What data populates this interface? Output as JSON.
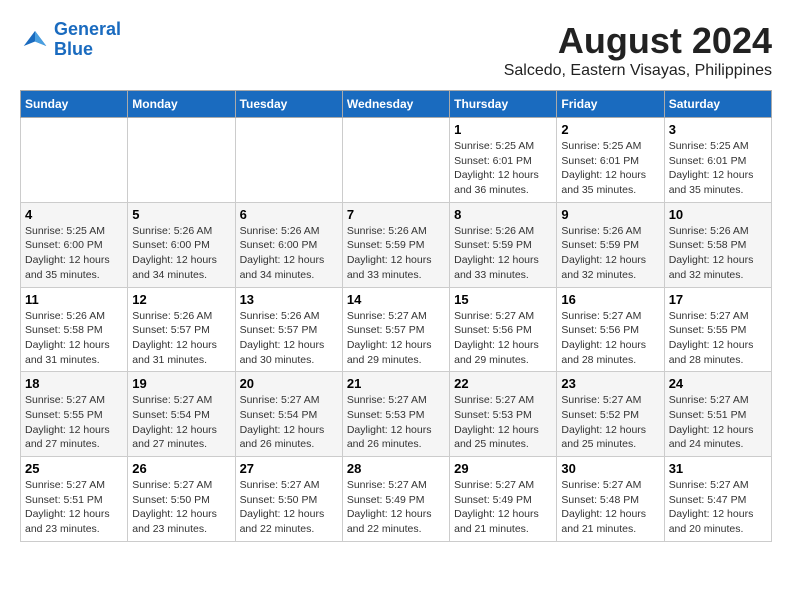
{
  "logo": {
    "line1": "General",
    "line2": "Blue"
  },
  "title": "August 2024",
  "subtitle": "Salcedo, Eastern Visayas, Philippines",
  "days_of_week": [
    "Sunday",
    "Monday",
    "Tuesday",
    "Wednesday",
    "Thursday",
    "Friday",
    "Saturday"
  ],
  "weeks": [
    [
      {
        "day": "",
        "info": ""
      },
      {
        "day": "",
        "info": ""
      },
      {
        "day": "",
        "info": ""
      },
      {
        "day": "",
        "info": ""
      },
      {
        "day": "1",
        "info": "Sunrise: 5:25 AM\nSunset: 6:01 PM\nDaylight: 12 hours\nand 36 minutes."
      },
      {
        "day": "2",
        "info": "Sunrise: 5:25 AM\nSunset: 6:01 PM\nDaylight: 12 hours\nand 35 minutes."
      },
      {
        "day": "3",
        "info": "Sunrise: 5:25 AM\nSunset: 6:01 PM\nDaylight: 12 hours\nand 35 minutes."
      }
    ],
    [
      {
        "day": "4",
        "info": "Sunrise: 5:25 AM\nSunset: 6:00 PM\nDaylight: 12 hours\nand 35 minutes."
      },
      {
        "day": "5",
        "info": "Sunrise: 5:26 AM\nSunset: 6:00 PM\nDaylight: 12 hours\nand 34 minutes."
      },
      {
        "day": "6",
        "info": "Sunrise: 5:26 AM\nSunset: 6:00 PM\nDaylight: 12 hours\nand 34 minutes."
      },
      {
        "day": "7",
        "info": "Sunrise: 5:26 AM\nSunset: 5:59 PM\nDaylight: 12 hours\nand 33 minutes."
      },
      {
        "day": "8",
        "info": "Sunrise: 5:26 AM\nSunset: 5:59 PM\nDaylight: 12 hours\nand 33 minutes."
      },
      {
        "day": "9",
        "info": "Sunrise: 5:26 AM\nSunset: 5:59 PM\nDaylight: 12 hours\nand 32 minutes."
      },
      {
        "day": "10",
        "info": "Sunrise: 5:26 AM\nSunset: 5:58 PM\nDaylight: 12 hours\nand 32 minutes."
      }
    ],
    [
      {
        "day": "11",
        "info": "Sunrise: 5:26 AM\nSunset: 5:58 PM\nDaylight: 12 hours\nand 31 minutes."
      },
      {
        "day": "12",
        "info": "Sunrise: 5:26 AM\nSunset: 5:57 PM\nDaylight: 12 hours\nand 31 minutes."
      },
      {
        "day": "13",
        "info": "Sunrise: 5:26 AM\nSunset: 5:57 PM\nDaylight: 12 hours\nand 30 minutes."
      },
      {
        "day": "14",
        "info": "Sunrise: 5:27 AM\nSunset: 5:57 PM\nDaylight: 12 hours\nand 29 minutes."
      },
      {
        "day": "15",
        "info": "Sunrise: 5:27 AM\nSunset: 5:56 PM\nDaylight: 12 hours\nand 29 minutes."
      },
      {
        "day": "16",
        "info": "Sunrise: 5:27 AM\nSunset: 5:56 PM\nDaylight: 12 hours\nand 28 minutes."
      },
      {
        "day": "17",
        "info": "Sunrise: 5:27 AM\nSunset: 5:55 PM\nDaylight: 12 hours\nand 28 minutes."
      }
    ],
    [
      {
        "day": "18",
        "info": "Sunrise: 5:27 AM\nSunset: 5:55 PM\nDaylight: 12 hours\nand 27 minutes."
      },
      {
        "day": "19",
        "info": "Sunrise: 5:27 AM\nSunset: 5:54 PM\nDaylight: 12 hours\nand 27 minutes."
      },
      {
        "day": "20",
        "info": "Sunrise: 5:27 AM\nSunset: 5:54 PM\nDaylight: 12 hours\nand 26 minutes."
      },
      {
        "day": "21",
        "info": "Sunrise: 5:27 AM\nSunset: 5:53 PM\nDaylight: 12 hours\nand 26 minutes."
      },
      {
        "day": "22",
        "info": "Sunrise: 5:27 AM\nSunset: 5:53 PM\nDaylight: 12 hours\nand 25 minutes."
      },
      {
        "day": "23",
        "info": "Sunrise: 5:27 AM\nSunset: 5:52 PM\nDaylight: 12 hours\nand 25 minutes."
      },
      {
        "day": "24",
        "info": "Sunrise: 5:27 AM\nSunset: 5:51 PM\nDaylight: 12 hours\nand 24 minutes."
      }
    ],
    [
      {
        "day": "25",
        "info": "Sunrise: 5:27 AM\nSunset: 5:51 PM\nDaylight: 12 hours\nand 23 minutes."
      },
      {
        "day": "26",
        "info": "Sunrise: 5:27 AM\nSunset: 5:50 PM\nDaylight: 12 hours\nand 23 minutes."
      },
      {
        "day": "27",
        "info": "Sunrise: 5:27 AM\nSunset: 5:50 PM\nDaylight: 12 hours\nand 22 minutes."
      },
      {
        "day": "28",
        "info": "Sunrise: 5:27 AM\nSunset: 5:49 PM\nDaylight: 12 hours\nand 22 minutes."
      },
      {
        "day": "29",
        "info": "Sunrise: 5:27 AM\nSunset: 5:49 PM\nDaylight: 12 hours\nand 21 minutes."
      },
      {
        "day": "30",
        "info": "Sunrise: 5:27 AM\nSunset: 5:48 PM\nDaylight: 12 hours\nand 21 minutes."
      },
      {
        "day": "31",
        "info": "Sunrise: 5:27 AM\nSunset: 5:47 PM\nDaylight: 12 hours\nand 20 minutes."
      }
    ]
  ]
}
